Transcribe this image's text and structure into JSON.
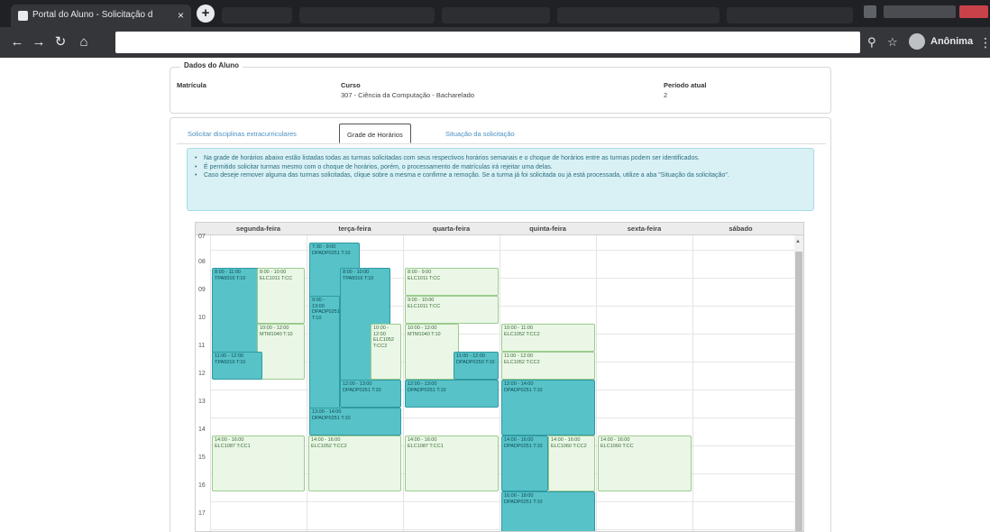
{
  "browser": {
    "active_tab_title": "Portal do Aluno - Solicitação d",
    "tab_close": "×",
    "new_tab": "+",
    "nav": {
      "back": "←",
      "forward": "→",
      "reload": "↻",
      "home": "⌂"
    },
    "icons": {
      "search": "⚲",
      "star": "☆"
    },
    "profile_name": "Anônima",
    "menu": "⋮"
  },
  "student": {
    "legend": "Dados do Aluno",
    "matricula_label": "Matrícula",
    "curso_label": "Curso",
    "curso_value": "307 - Ciência da Computação - Bacharelado",
    "periodo_label": "Período atual",
    "periodo_value": "2"
  },
  "tabs": [
    {
      "label": "Solicitar disciplinas extracurriculares",
      "active": false
    },
    {
      "label": "Grade de Horários",
      "active": true
    },
    {
      "label": "Situação da solicitação",
      "active": false
    }
  ],
  "notice": {
    "bullet": "•",
    "items": [
      "Na grade de horários abaixo estão listadas todas as turmas solicitadas com seus respectivos horários semanais e o choque de horários entre as turmas podem ser identificados.",
      "É permitido solicitar turmas mesmo com o choque de horários, porém, o processamento de matrículas irá rejeitar uma delas.",
      "Caso deseje remover alguma das turmas solicitadas, clique sobre a mesma e confirme a remoção. Se a turma já foi solicitada ou já está processada, utilize a aba \"Situação da solicitação\"."
    ]
  },
  "calendar": {
    "days": [
      "segunda-feira",
      "terça-feira",
      "quarta-feira",
      "quinta-feira",
      "sexta-feira",
      "sábado"
    ],
    "hours": [
      "07",
      "08",
      "09",
      "10",
      "11",
      "12",
      "13",
      "14",
      "15",
      "16",
      "17"
    ],
    "scroll_up": "▲",
    "events": [
      {
        "time": "7:30 - 9:00",
        "code": "DPADP0251 T:10",
        "color": "teal"
      },
      {
        "time": "8:00 - 11:00",
        "code": "TPA5016 T:10",
        "color": "teal"
      },
      {
        "time": "8:00 - 10:00",
        "code": "ELC1011 T:CC",
        "color": "green"
      },
      {
        "time": "8:00 - 10:00",
        "code": "TPA5016 T:10",
        "color": "teal"
      },
      {
        "time": "8:00 - 9:00",
        "code": "ELC1011 T:CC",
        "color": "green"
      },
      {
        "time": "9:00 - 13:00",
        "code": "DPADP0251 T:10",
        "color": "teal"
      },
      {
        "time": "9:00 - 10:00",
        "code": "ELC1011 T:CC",
        "color": "green"
      },
      {
        "time": "10:00 - 12:00",
        "code": "MTM1040 T:10",
        "color": "green"
      },
      {
        "time": "10:00 - 12:00",
        "code": "ELC1052 T:CC2",
        "color": "green"
      },
      {
        "time": "10:00 - 12:00",
        "code": "MTM1040 T:10",
        "color": "green"
      },
      {
        "time": "10:00 - 11:00",
        "code": "ELC1052 T:CC2",
        "color": "green"
      },
      {
        "time": "11:00 - 12:00",
        "code": "TPA5016 T:10",
        "color": "teal"
      },
      {
        "time": "11:00 - 12:00",
        "code": "DPADP0250 T:10",
        "color": "teal"
      },
      {
        "time": "11:00 - 12:00",
        "code": "ELC1052 T:CC2",
        "color": "green"
      },
      {
        "time": "12:00 - 13:00",
        "code": "DPADP0251 T:10",
        "color": "teal"
      },
      {
        "time": "12:00 - 13:00",
        "code": "DPADP0251 T:10",
        "color": "teal"
      },
      {
        "time": "12:00 - 14:00",
        "code": "DPADP0251 T:10",
        "color": "teal"
      },
      {
        "time": "13:00 - 14:00",
        "code": "DPADP0251 T:10",
        "color": "teal"
      },
      {
        "time": "14:00 - 16:00",
        "code": "ELC1087 T:CC1",
        "color": "green"
      },
      {
        "time": "14:00 - 16:00",
        "code": "ELC1052 T:CC2",
        "color": "green"
      },
      {
        "time": "14:00 - 16:00",
        "code": "ELC1087 T:CC1",
        "color": "green"
      },
      {
        "time": "14:00 - 16:00",
        "code": "DPADP0251 T:10",
        "color": "teal"
      },
      {
        "time": "14:00 - 16:00",
        "code": "ELC1060 T:CC2",
        "color": "green"
      },
      {
        "time": "14:00 - 16:00",
        "code": "ELC1060 T:CC",
        "color": "green"
      },
      {
        "time": "16:00 - 18:00",
        "code": "DPADP0251 T:10",
        "color": "teal"
      }
    ]
  }
}
